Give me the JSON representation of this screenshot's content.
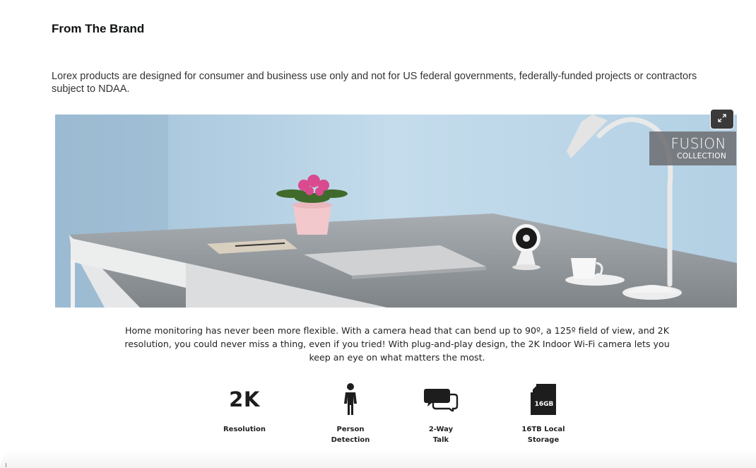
{
  "section": {
    "heading": "From The Brand",
    "disclaimer": "Lorex products are designed for consumer and business use only and not for US federal governments, federally-funded projects or contractors subject to NDAA."
  },
  "hero": {
    "badge_title": "FUSION",
    "badge_subtitle": "COLLECTION",
    "expand_icon": "expand-arrows-icon"
  },
  "description": "Home monitoring has never been more flexible. With a camera head that can bend up to 90º, a 125º field of view, and 2K resolution, you could never miss a thing, even if you tried! With plug-and-play design, the 2K Indoor Wi-Fi camera lets you keep an eye on what matters the most.",
  "features": [
    {
      "icon": "2k-text-icon",
      "icon_text": "2K",
      "label": "Resolution"
    },
    {
      "icon": "person-icon",
      "label": "Person\nDetection"
    },
    {
      "icon": "chat-bubbles-icon",
      "label": "2-Way\nTalk"
    },
    {
      "icon": "sd-card-icon",
      "icon_text": "16GB",
      "label": "16TB Local\nStorage"
    }
  ]
}
